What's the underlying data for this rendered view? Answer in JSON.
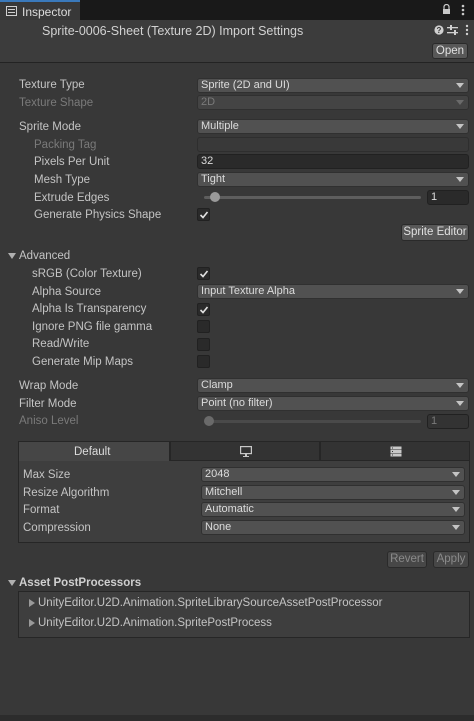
{
  "tab": {
    "title": "Inspector",
    "lock_icon": "lock-icon",
    "menu_icon": "kebab-menu-icon"
  },
  "header": {
    "title": "Sprite-0006-Sheet (Texture 2D) Import Settings",
    "open_label": "Open",
    "icons": [
      "help-icon",
      "preset-icon",
      "kebab-menu-icon"
    ]
  },
  "fields": {
    "texture_type": {
      "label": "Texture Type",
      "value": "Sprite (2D and UI)"
    },
    "texture_shape": {
      "label": "Texture Shape",
      "value": "2D"
    },
    "sprite_mode": {
      "label": "Sprite Mode",
      "value": "Multiple"
    },
    "packing_tag": {
      "label": "Packing Tag",
      "value": ""
    },
    "pixels_per_unit": {
      "label": "Pixels Per Unit",
      "value": "32"
    },
    "mesh_type": {
      "label": "Mesh Type",
      "value": "Tight"
    },
    "extrude_edges": {
      "label": "Extrude Edges",
      "value": "1",
      "slider_fraction": 0.03
    },
    "generate_physics_shape": {
      "label": "Generate Physics Shape",
      "checked": true
    },
    "sprite_editor_label": "Sprite Editor"
  },
  "advanced": {
    "title": "Advanced",
    "srgb": {
      "label": "sRGB (Color Texture)",
      "checked": true
    },
    "alpha_source": {
      "label": "Alpha Source",
      "value": "Input Texture Alpha"
    },
    "alpha_is_transparency": {
      "label": "Alpha Is Transparency",
      "checked": true
    },
    "ignore_png_gamma": {
      "label": "Ignore PNG file gamma",
      "checked": false
    },
    "read_write": {
      "label": "Read/Write",
      "checked": false
    },
    "generate_mip_maps": {
      "label": "Generate Mip Maps",
      "checked": false
    }
  },
  "sampling": {
    "wrap_mode": {
      "label": "Wrap Mode",
      "value": "Clamp"
    },
    "filter_mode": {
      "label": "Filter Mode",
      "value": "Point (no filter)"
    },
    "aniso_level": {
      "label": "Aniso Level",
      "value": "1",
      "slider_fraction": 0.0
    }
  },
  "platform": {
    "tabs": [
      {
        "label": "Default",
        "active": true
      },
      {
        "icon": "monitor-icon"
      },
      {
        "icon": "server-icon"
      }
    ],
    "max_size": {
      "label": "Max Size",
      "value": "2048"
    },
    "resize_algorithm": {
      "label": "Resize Algorithm",
      "value": "Mitchell"
    },
    "format": {
      "label": "Format",
      "value": "Automatic"
    },
    "compression": {
      "label": "Compression",
      "value": "None"
    }
  },
  "actions": {
    "revert_label": "Revert",
    "apply_label": "Apply"
  },
  "postprocessors": {
    "title": "Asset PostProcessors",
    "items": [
      "UnityEditor.U2D.Animation.SpriteLibrarySourceAssetPostProcessor",
      "UnityEditor.U2D.Animation.SpritePostProcess"
    ]
  }
}
